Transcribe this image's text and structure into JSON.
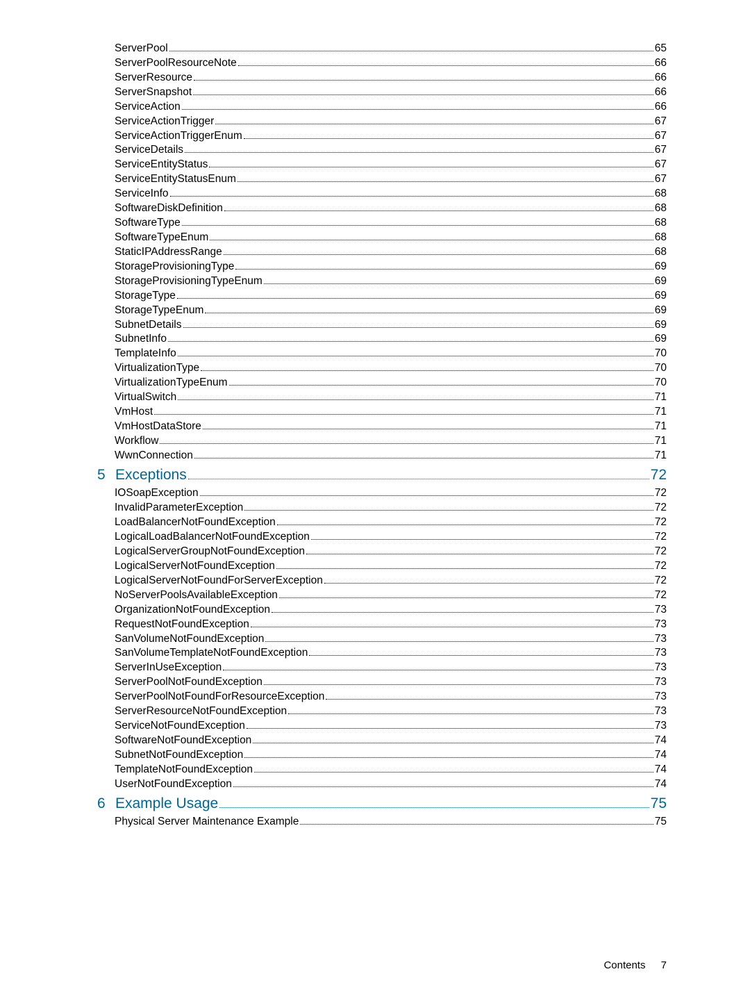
{
  "entries": [
    {
      "label": "ServerPool",
      "page": "65",
      "indent": 1
    },
    {
      "label": "ServerPoolResourceNote",
      "page": "66",
      "indent": 1
    },
    {
      "label": "ServerResource",
      "page": "66",
      "indent": 1
    },
    {
      "label": "ServerSnapshot",
      "page": "66",
      "indent": 1
    },
    {
      "label": "ServiceAction",
      "page": "66",
      "indent": 1
    },
    {
      "label": "ServiceActionTrigger",
      "page": "67",
      "indent": 1
    },
    {
      "label": "ServiceActionTriggerEnum",
      "page": "67",
      "indent": 1
    },
    {
      "label": "ServiceDetails",
      "page": "67",
      "indent": 1
    },
    {
      "label": "ServiceEntityStatus",
      "page": "67",
      "indent": 1
    },
    {
      "label": "ServiceEntityStatusEnum",
      "page": "67",
      "indent": 1
    },
    {
      "label": "ServiceInfo",
      "page": "68",
      "indent": 1
    },
    {
      "label": "SoftwareDiskDefinition",
      "page": "68",
      "indent": 1
    },
    {
      "label": "SoftwareType",
      "page": "68",
      "indent": 1
    },
    {
      "label": "SoftwareTypeEnum",
      "page": "68",
      "indent": 1
    },
    {
      "label": "StaticIPAddressRange",
      "page": "68",
      "indent": 1
    },
    {
      "label": "StorageProvisioningType",
      "page": "69",
      "indent": 1
    },
    {
      "label": "StorageProvisioningTypeEnum",
      "page": "69",
      "indent": 1
    },
    {
      "label": "StorageType",
      "page": "69",
      "indent": 1
    },
    {
      "label": "StorageTypeEnum",
      "page": "69",
      "indent": 1
    },
    {
      "label": "SubnetDetails",
      "page": "69",
      "indent": 1
    },
    {
      "label": "SubnetInfo",
      "page": "69",
      "indent": 1
    },
    {
      "label": "TemplateInfo",
      "page": "70",
      "indent": 1
    },
    {
      "label": "VirtualizationType",
      "page": "70",
      "indent": 1
    },
    {
      "label": "VirtualizationTypeEnum",
      "page": "70",
      "indent": 1
    },
    {
      "label": "VirtualSwitch",
      "page": "71",
      "indent": 1
    },
    {
      "label": "VmHost",
      "page": "71",
      "indent": 1
    },
    {
      "label": "VmHostDataStore",
      "page": "71",
      "indent": 1
    },
    {
      "label": "Workflow",
      "page": "71",
      "indent": 1
    },
    {
      "label": "WwnConnection",
      "page": "71",
      "indent": 1
    },
    {
      "num": "5",
      "label": "Exceptions",
      "page": "72",
      "indent": 0,
      "chapter": true
    },
    {
      "label": "IOSoapException",
      "page": "72",
      "indent": 1
    },
    {
      "label": "InvalidParameterException",
      "page": "72",
      "indent": 1
    },
    {
      "label": "LoadBalancerNotFoundException",
      "page": "72",
      "indent": 1
    },
    {
      "label": "LogicalLoadBalancerNotFoundException",
      "page": "72",
      "indent": 1
    },
    {
      "label": "LogicalServerGroupNotFoundException",
      "page": "72",
      "indent": 1
    },
    {
      "label": "LogicalServerNotFoundException",
      "page": "72",
      "indent": 1
    },
    {
      "label": "LogicalServerNotFoundForServerException",
      "page": "72",
      "indent": 1
    },
    {
      "label": "NoServerPoolsAvailableException",
      "page": "72",
      "indent": 1
    },
    {
      "label": "OrganizationNotFoundException",
      "page": "73",
      "indent": 1
    },
    {
      "label": "RequestNotFoundException",
      "page": "73",
      "indent": 1
    },
    {
      "label": "SanVolumeNotFoundException",
      "page": "73",
      "indent": 1
    },
    {
      "label": "SanVolumeTemplateNotFoundException",
      "page": "73",
      "indent": 1
    },
    {
      "label": "ServerInUseException",
      "page": "73",
      "indent": 1
    },
    {
      "label": "ServerPoolNotFoundException",
      "page": "73",
      "indent": 1
    },
    {
      "label": "ServerPoolNotFoundForResourceException",
      "page": "73",
      "indent": 1
    },
    {
      "label": "ServerResourceNotFoundException",
      "page": "73",
      "indent": 1
    },
    {
      "label": "ServiceNotFoundException",
      "page": "73",
      "indent": 1
    },
    {
      "label": "SoftwareNotFoundException",
      "page": "74",
      "indent": 1
    },
    {
      "label": "SubnetNotFoundException",
      "page": "74",
      "indent": 1
    },
    {
      "label": "TemplateNotFoundException",
      "page": "74",
      "indent": 1
    },
    {
      "label": "UserNotFoundException",
      "page": "74",
      "indent": 1
    },
    {
      "num": "6",
      "label": "Example Usage",
      "page": "75",
      "indent": 0,
      "chapter": true
    },
    {
      "label": "Physical Server Maintenance Example",
      "page": "75",
      "indent": 1
    }
  ],
  "footer": {
    "label": "Contents",
    "page": "7"
  }
}
